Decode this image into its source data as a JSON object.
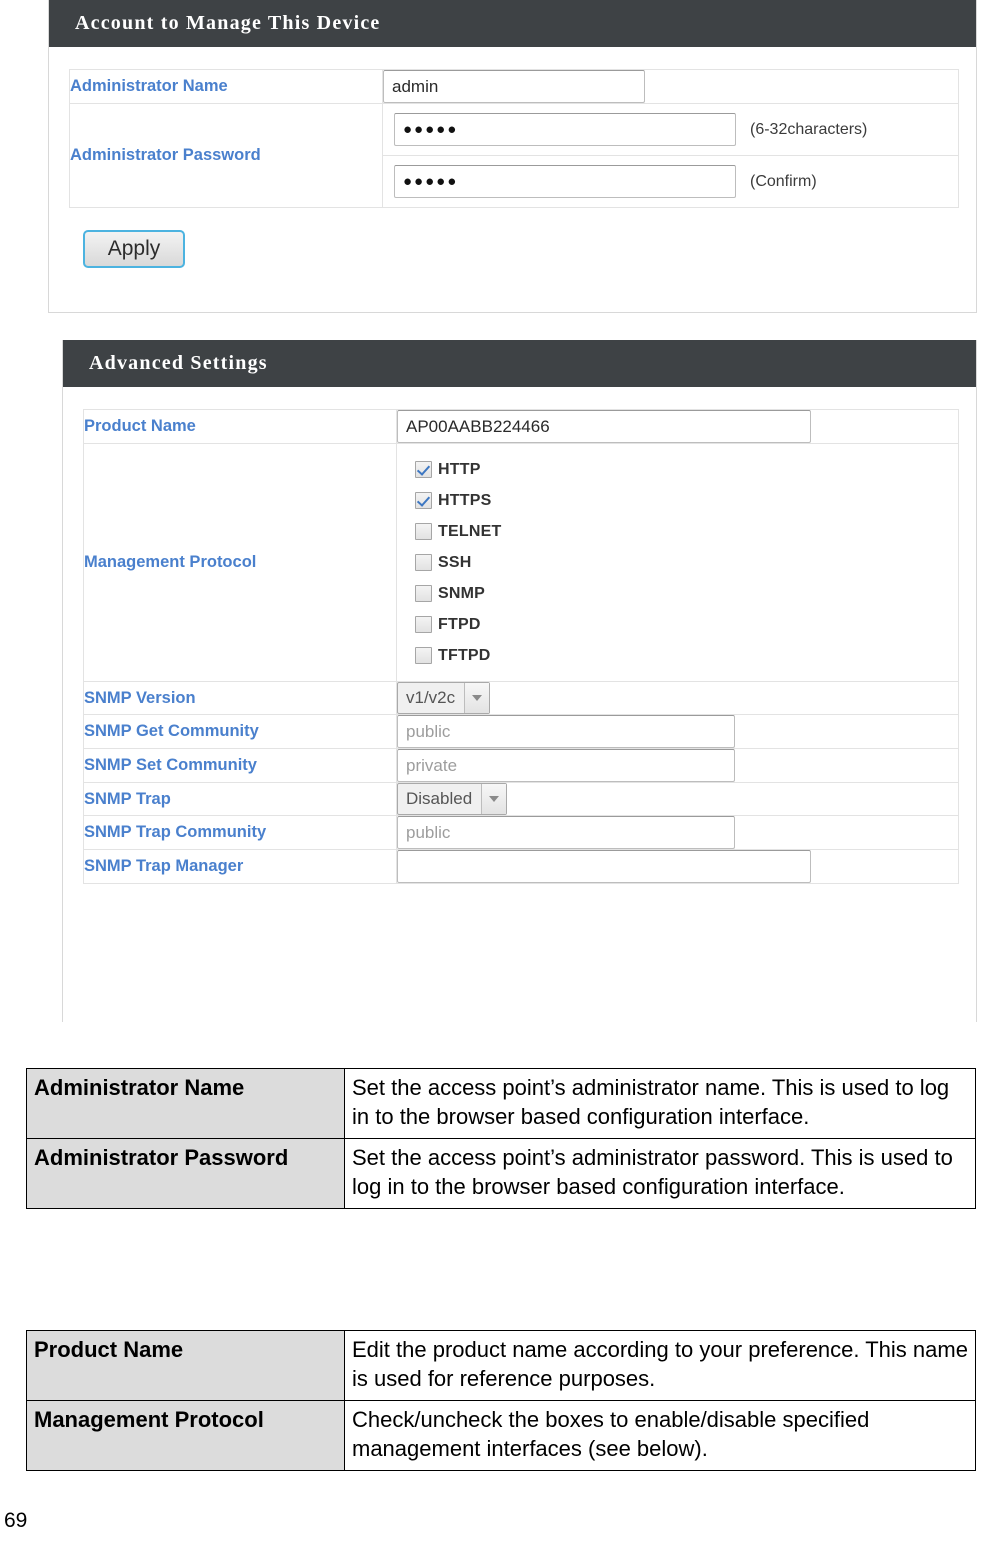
{
  "panels": [
    {
      "title": "Account to Manage This Device",
      "rows": {
        "admin_name_label": "Administrator Name",
        "admin_name_value": "admin",
        "admin_password_label": "Administrator Password",
        "admin_password_value": "●●●●●",
        "admin_password_hint": "(6-32characters)",
        "admin_password_confirm_value": "●●●●●",
        "admin_password_confirm_hint": "(Confirm)"
      },
      "apply_label": "Apply"
    },
    {
      "title": "Advanced Settings",
      "rows": {
        "product_name_label": "Product Name",
        "product_name_value": "AP00AABB224466",
        "management_protocol_label": "Management Protocol",
        "protocols": [
          {
            "label": "HTTP",
            "checked": true
          },
          {
            "label": "HTTPS",
            "checked": true
          },
          {
            "label": "TELNET",
            "checked": false
          },
          {
            "label": "SSH",
            "checked": false
          },
          {
            "label": "SNMP",
            "checked": false
          },
          {
            "label": "FTPD",
            "checked": false
          },
          {
            "label": "TFTPD",
            "checked": false
          }
        ],
        "snmp_version_label": "SNMP Version",
        "snmp_version_value": "v1/v2c",
        "snmp_get_community_label": "SNMP Get Community",
        "snmp_get_community_value": "public",
        "snmp_set_community_label": "SNMP Set Community",
        "snmp_set_community_value": "private",
        "snmp_trap_label": "SNMP Trap",
        "snmp_trap_value": "Disabled",
        "snmp_trap_community_label": "SNMP Trap Community",
        "snmp_trap_community_value": "public",
        "snmp_trap_manager_label": "SNMP Trap Manager",
        "snmp_trap_manager_value": ""
      }
    }
  ],
  "doc_tables": [
    {
      "rows": [
        {
          "key": "Administrator Name",
          "value": "Set the access point’s administrator name. This is used to log in to the browser based configuration interface."
        },
        {
          "key": "Administrator Password",
          "value": "Set the access point’s administrator password. This is used to log in to the browser based configuration interface."
        }
      ]
    },
    {
      "rows": [
        {
          "key": "Product Name",
          "value": "Edit the product name according to your preference. This name is used for reference purposes."
        },
        {
          "key": "Management Protocol",
          "value": "Check/uncheck the boxes to enable/disable specified management interfaces (see below)."
        }
      ]
    }
  ],
  "page_number": "69",
  "colors": {
    "header_bar": "#3e4245",
    "label_blue": "#4a80cd",
    "checkmark_blue": "#3d77c2",
    "apply_border": "#4cb3e0",
    "doc_key_bg": "#dcdcdc"
  }
}
